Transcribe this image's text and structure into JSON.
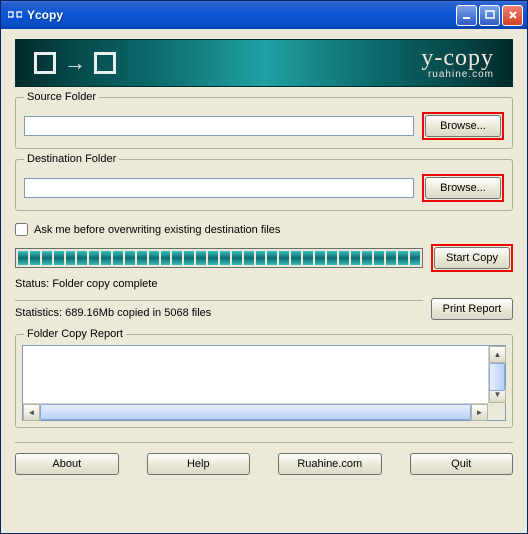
{
  "window": {
    "title": "Ycopy"
  },
  "banner": {
    "logo": "y-copy",
    "subtitle": "ruahine.com"
  },
  "source": {
    "label": "Source Folder",
    "value": "",
    "browse": "Browse..."
  },
  "destination": {
    "label": "Destination Folder",
    "value": "",
    "browse": "Browse..."
  },
  "options": {
    "ask_overwrite": "Ask me before overwriting existing destination files",
    "start_copy": "Start Copy"
  },
  "status": {
    "label": "Status:",
    "text": "Folder copy complete"
  },
  "statistics": {
    "label": "Statistics:",
    "text": "689.16Mb copied in 5068 files",
    "print": "Print Report"
  },
  "report": {
    "label": "Folder Copy Report",
    "content": ""
  },
  "footer": {
    "about": "About",
    "help": "Help",
    "ruahine": "Ruahine.com",
    "quit": "Quit"
  }
}
